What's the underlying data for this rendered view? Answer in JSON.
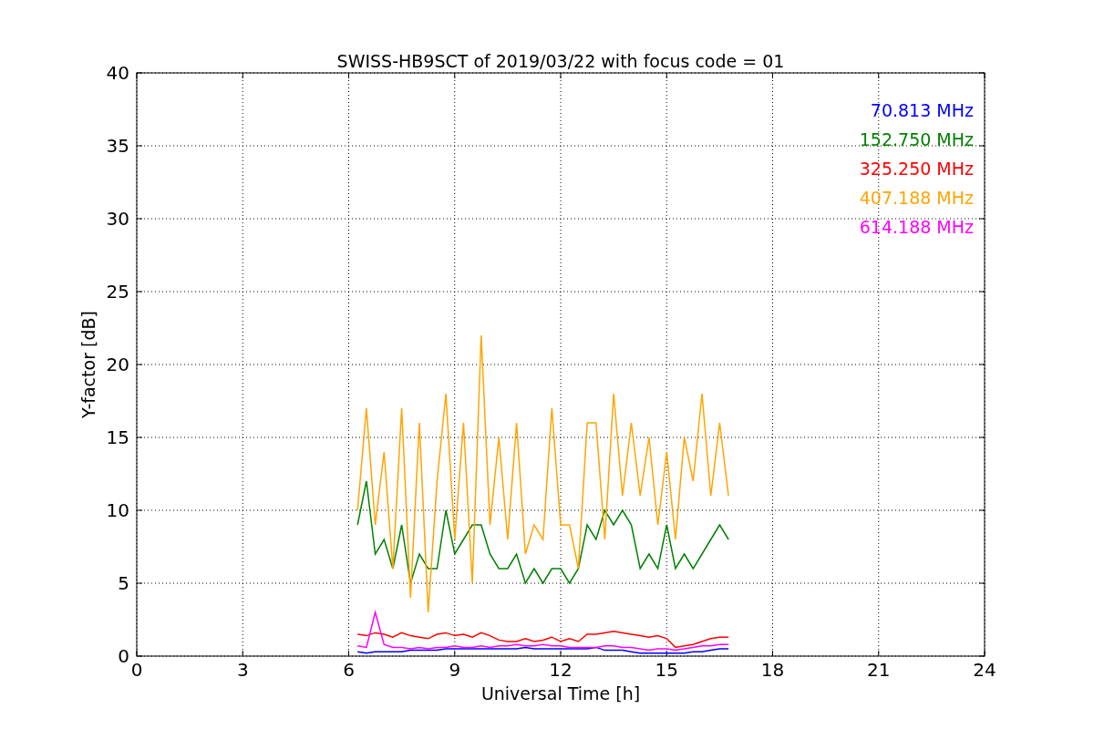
{
  "figure": {
    "chart_data": {
      "type": "line",
      "title": "SWISS-HB9SCT of 2019/03/22 with focus code = 01",
      "xlabel": "Universal Time [h]",
      "ylabel": "Y-factor [dB]",
      "x": [
        6.25,
        6.5,
        6.75,
        7,
        7.25,
        7.5,
        7.75,
        8,
        8.25,
        8.5,
        8.75,
        9,
        9.25,
        9.5,
        9.75,
        10,
        10.25,
        10.5,
        10.75,
        11,
        11.25,
        11.5,
        11.75,
        12,
        12.25,
        12.5,
        12.75,
        13,
        13.25,
        13.5,
        13.75,
        14,
        14.25,
        14.5,
        14.75,
        15,
        15.25,
        15.5,
        15.75,
        16,
        16.25,
        16.5,
        16.75
      ],
      "series": [
        {
          "name": "70.813 MHz",
          "color": "#0000ff",
          "values": [
            0.3,
            0.2,
            0.3,
            0.3,
            0.3,
            0.3,
            0.4,
            0.4,
            0.4,
            0.4,
            0.5,
            0.5,
            0.5,
            0.5,
            0.5,
            0.5,
            0.5,
            0.5,
            0.5,
            0.6,
            0.5,
            0.5,
            0.5,
            0.5,
            0.5,
            0.5,
            0.5,
            0.6,
            0.4,
            0.4,
            0.4,
            0.3,
            0.2,
            0.2,
            0.2,
            0.2,
            0.2,
            0.2,
            0.3,
            0.3,
            0.4,
            0.5,
            0.5
          ]
        },
        {
          "name": "152.750 MHz",
          "color": "#008000",
          "values": [
            9,
            12,
            7,
            8,
            6,
            9,
            5,
            7,
            6,
            6,
            10,
            7,
            8,
            9,
            9,
            7,
            6,
            6,
            7,
            5,
            6,
            5,
            6,
            6,
            5,
            6,
            9,
            8,
            10,
            9,
            10,
            9,
            6,
            7,
            6,
            9,
            6,
            7,
            6,
            7,
            8,
            9,
            8
          ]
        },
        {
          "name": "325.250 MHz",
          "color": "#ff0000",
          "values": [
            1.5,
            1.4,
            1.6,
            1.5,
            1.3,
            1.6,
            1.4,
            1.3,
            1.2,
            1.5,
            1.6,
            1.4,
            1.5,
            1.3,
            1.6,
            1.4,
            1.1,
            1.0,
            1.0,
            1.2,
            1.0,
            1.1,
            1.3,
            1.0,
            1.2,
            1.0,
            1.5,
            1.5,
            1.6,
            1.7,
            1.6,
            1.5,
            1.4,
            1.3,
            1.4,
            1.2,
            0.6,
            0.7,
            0.8,
            1.0,
            1.2,
            1.3,
            1.3
          ]
        },
        {
          "name": "407.188 MHz",
          "color": "#ffa500",
          "values": [
            10,
            17,
            9,
            14,
            6,
            17,
            4,
            16,
            3,
            12,
            18,
            8,
            16,
            5,
            22,
            9,
            15,
            8,
            16,
            7,
            9,
            8,
            17,
            9,
            9,
            6,
            16,
            16,
            8,
            18,
            11,
            16,
            11,
            15,
            9,
            14,
            8,
            15,
            12,
            18,
            11,
            16,
            11
          ]
        },
        {
          "name": "614.188 MHz",
          "color": "#ff00ff",
          "values": [
            0.7,
            0.6,
            3.0,
            0.8,
            0.6,
            0.6,
            0.5,
            0.6,
            0.5,
            0.6,
            0.6,
            0.7,
            0.6,
            0.6,
            0.7,
            0.6,
            0.7,
            0.7,
            0.8,
            0.7,
            0.7,
            0.8,
            0.7,
            0.7,
            0.6,
            0.6,
            0.6,
            0.6,
            0.7,
            0.7,
            0.6,
            0.6,
            0.5,
            0.4,
            0.5,
            0.5,
            0.4,
            0.5,
            0.6,
            0.7,
            0.7,
            0.8,
            0.8
          ]
        }
      ],
      "xlim": [
        0,
        24
      ],
      "ylim": [
        0,
        40
      ],
      "xticks": [
        0,
        3,
        6,
        9,
        12,
        15,
        18,
        21,
        24
      ],
      "yticks": [
        0,
        5,
        10,
        15,
        20,
        25,
        30,
        35,
        40
      ],
      "grid": true
    }
  }
}
